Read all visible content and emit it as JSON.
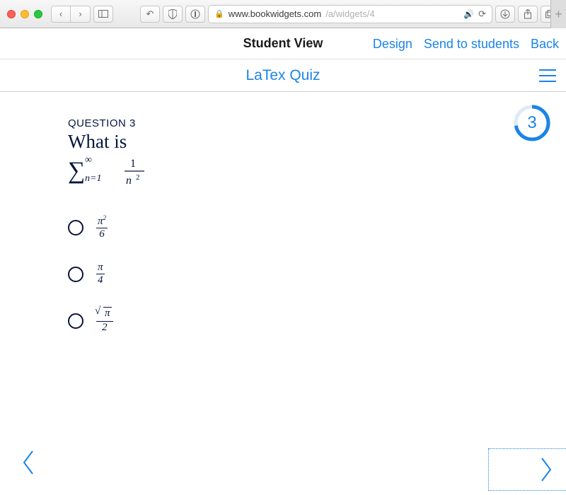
{
  "browser": {
    "url_domain": "www.bookwidgets.com",
    "url_rest": "/a/widgets/4"
  },
  "app_top": {
    "title": "Student View",
    "links": {
      "design": "Design",
      "send": "Send to students",
      "back": "Back"
    }
  },
  "quiz": {
    "title": "LaTex Quiz",
    "counter": "3",
    "question_label": "QUESTION 3",
    "question_text": "What is",
    "options_desc": {
      "a": "π² / 6",
      "b": "π / 4",
      "c": "√π / 2"
    }
  }
}
